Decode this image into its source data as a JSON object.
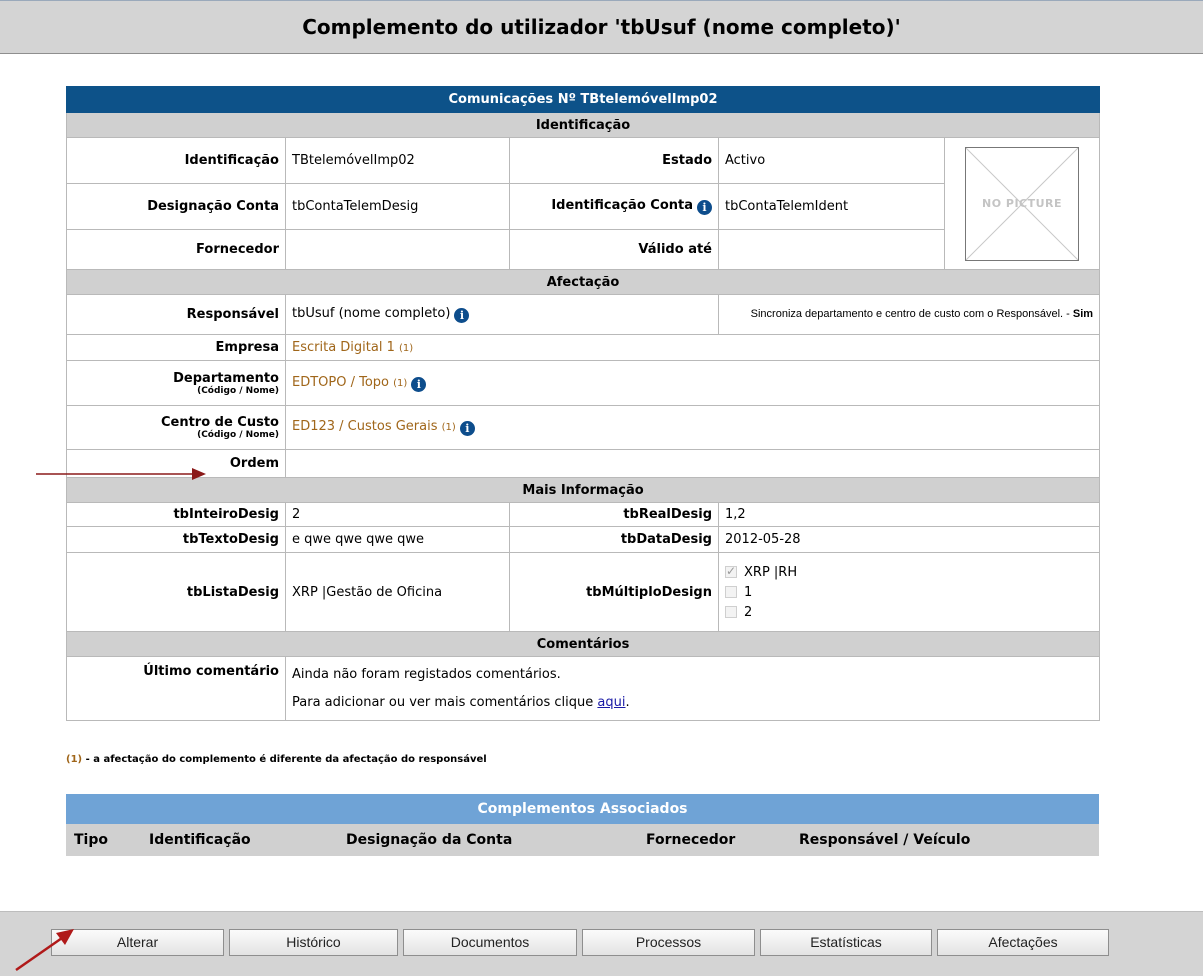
{
  "header": {
    "title": "Complemento do utilizador 'tbUsuf (nome completo)'"
  },
  "card": {
    "title": "Comunicações Nº TBtelemóvelImp02",
    "sections": {
      "identificacao": "Identificação",
      "afectacao": "Afectação",
      "mais_info": "Mais Informação",
      "comentarios": "Comentários"
    },
    "ident": {
      "identificacao_label": "Identificação",
      "identificacao_value": "TBtelemóvelImp02",
      "estado_label": "Estado",
      "estado_value": "Activo",
      "designacao_label": "Designação Conta",
      "designacao_value": "tbContaTelemDesig",
      "ident_conta_label": "Identificação Conta",
      "ident_conta_value": "tbContaTelemIdent",
      "fornecedor_label": "Fornecedor",
      "fornecedor_value": "",
      "valido_label": "Válido até",
      "valido_value": "",
      "no_picture": "NO PICTURE"
    },
    "afect": {
      "responsavel_label": "Responsável",
      "responsavel_value": "tbUsuf (nome completo)",
      "sync_text": "Sincroniza departamento e centro de custo com o Responsável. -",
      "sync_value": "Sim",
      "empresa_label": "Empresa",
      "empresa_value": "Escrita Digital 1",
      "empresa_note": "(1)",
      "departamento_label": "Departamento",
      "departamento_sub": "(Código / Nome)",
      "departamento_value": "EDTOPO / Topo",
      "departamento_note": "(1)",
      "centro_label": "Centro de Custo",
      "centro_sub": "(Código / Nome)",
      "centro_value": "ED123 / Custos Gerais",
      "centro_note": "(1)",
      "ordem_label": "Ordem",
      "ordem_value": ""
    },
    "mais": {
      "inteiro_label": "tbInteiroDesig",
      "inteiro_value": "2",
      "real_label": "tbRealDesig",
      "real_value": "1,2",
      "texto_label": "tbTextoDesig",
      "texto_value": "e qwe qwe qwe qwe",
      "data_label": "tbDataDesig",
      "data_value": "2012-05-28",
      "lista_label": "tbListaDesig",
      "lista_value": "XRP |Gestão de Oficina",
      "multiplo_label": "tbMúltiploDesign",
      "multiplo_options": [
        {
          "label": "XRP |RH",
          "checked": true
        },
        {
          "label": "1",
          "checked": false
        },
        {
          "label": "2",
          "checked": false
        }
      ]
    },
    "coment": {
      "ultimo_label": "Último comentário",
      "line1": "Ainda não foram registados comentários.",
      "line2_prefix": "Para adicionar ou ver mais comentários clique",
      "link": "aqui",
      "line2_suffix": "."
    }
  },
  "footnote": {
    "number": "(1)",
    "text": "- a afectação do complemento é diferente da afectação do responsável"
  },
  "associados": {
    "title": "Complementos Associados",
    "columns": [
      "Tipo",
      "Identificação",
      "Designação da Conta",
      "Fornecedor",
      "Responsável / Veículo"
    ]
  },
  "buttons": [
    "Alterar",
    "Histórico",
    "Documentos",
    "Processos",
    "Estatísticas",
    "Afectações"
  ],
  "colors": {
    "header_blue": "#0d5289",
    "section_gray": "#d0d0d0",
    "assoc_blue": "#6fa3d6",
    "note_orange": "#a0661a",
    "arrow_red": "#8b1a1a"
  }
}
